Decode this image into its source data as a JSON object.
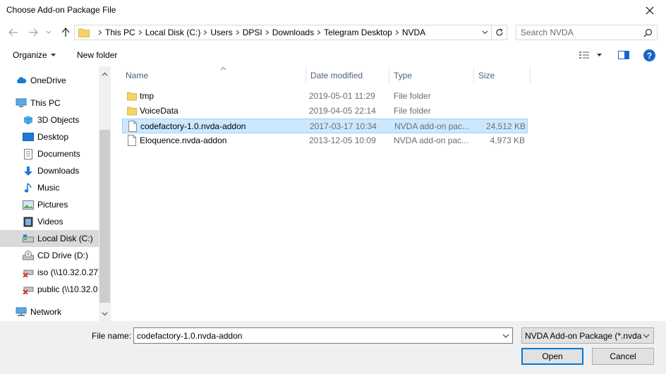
{
  "window": {
    "title": "Choose Add-on Package File"
  },
  "breadcrumb": [
    {
      "label": "This PC"
    },
    {
      "label": "Local Disk (C:)"
    },
    {
      "label": "Users"
    },
    {
      "label": "DPSI"
    },
    {
      "label": "Downloads"
    },
    {
      "label": "Telegram Desktop"
    },
    {
      "label": "NVDA"
    }
  ],
  "search": {
    "placeholder": "Search NVDA"
  },
  "toolbar": {
    "organize_label": "Organize",
    "new_folder_label": "New folder"
  },
  "nav": {
    "items": [
      {
        "label": "OneDrive",
        "icon": "cloud-icon"
      },
      {
        "label": "This PC",
        "icon": "computer-icon"
      },
      {
        "label": "3D Objects",
        "icon": "cube-icon"
      },
      {
        "label": "Desktop",
        "icon": "desktop-icon"
      },
      {
        "label": "Documents",
        "icon": "document-icon"
      },
      {
        "label": "Downloads",
        "icon": "download-arrow-icon"
      },
      {
        "label": "Music",
        "icon": "music-note-icon"
      },
      {
        "label": "Pictures",
        "icon": "picture-icon"
      },
      {
        "label": "Videos",
        "icon": "film-icon"
      },
      {
        "label": "Local Disk (C:)",
        "icon": "hard-disk-icon"
      },
      {
        "label": "CD Drive (D:)",
        "icon": "cd-drive-icon"
      },
      {
        "label": "iso (\\\\10.32.0.27)",
        "icon": "disconnected-network-drive-icon"
      },
      {
        "label": "public (\\\\10.32.0",
        "icon": "disconnected-network-drive-icon"
      },
      {
        "label": "Network",
        "icon": "network-icon"
      }
    ],
    "selected": "Local Disk (C:)"
  },
  "columns": {
    "name": "Name",
    "date": "Date modified",
    "type": "Type",
    "size": "Size"
  },
  "files": [
    {
      "name": "tmp",
      "date": "2019-05-01 11:29",
      "type": "File folder",
      "size": "",
      "icon": "folder-icon"
    },
    {
      "name": "VoiceData",
      "date": "2019-04-05 22:14",
      "type": "File folder",
      "size": "",
      "icon": "folder-icon"
    },
    {
      "name": "codefactory-1.0.nvda-addon",
      "date": "2017-03-17 10:34",
      "type": "NVDA add-on pac...",
      "size": "24,512 KB",
      "icon": "file-icon"
    },
    {
      "name": "Eloquence.nvda-addon",
      "date": "2013-12-05 10:09",
      "type": "NVDA add-on pac...",
      "size": "4,973 KB",
      "icon": "file-icon"
    }
  ],
  "selected_file": "codefactory-1.0.nvda-addon",
  "bottom": {
    "file_name_label": "File name:",
    "file_name_value": "codefactory-1.0.nvda-addon",
    "filter_value": "NVDA Add-on Package (*.nvda",
    "open_label": "Open",
    "cancel_label": "Cancel"
  },
  "colors": {
    "selection_bg": "#cce8ff",
    "selection_border": "#99d1ff",
    "folder": "#e8bf4f",
    "accent": "#0078d7"
  }
}
